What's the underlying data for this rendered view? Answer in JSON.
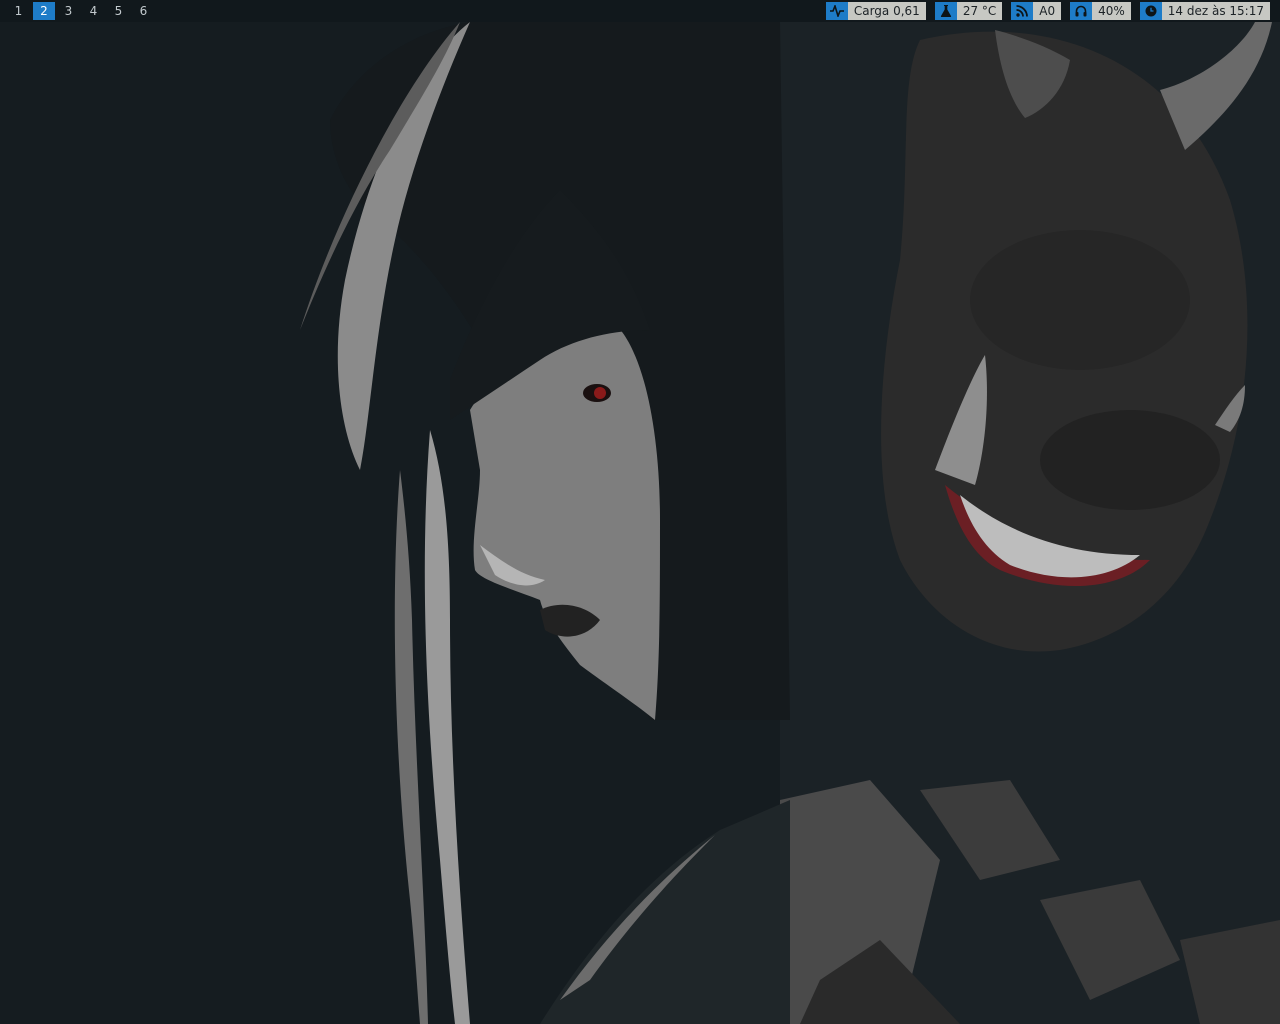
{
  "workspaces": [
    {
      "label": "1",
      "active": false
    },
    {
      "label": "2",
      "active": true
    },
    {
      "label": "3",
      "active": false
    },
    {
      "label": "4",
      "active": false
    },
    {
      "label": "5",
      "active": false
    },
    {
      "label": "6",
      "active": false
    }
  ],
  "status": {
    "load": {
      "icon": "activity-icon",
      "text": "Carga 0,61"
    },
    "temperature": {
      "icon": "flask-icon",
      "text": "27 °C"
    },
    "network": {
      "icon": "rss-icon",
      "text": "A0"
    },
    "volume": {
      "icon": "headphones-icon",
      "text": "40%"
    },
    "clock": {
      "icon": "clock-icon",
      "text": "14 dez às 15:17"
    }
  },
  "colors": {
    "bar_background": "#11181c",
    "accent": "#1e7cc8",
    "block_background": "#c7c8c3",
    "wallpaper_base": "#151c20"
  }
}
